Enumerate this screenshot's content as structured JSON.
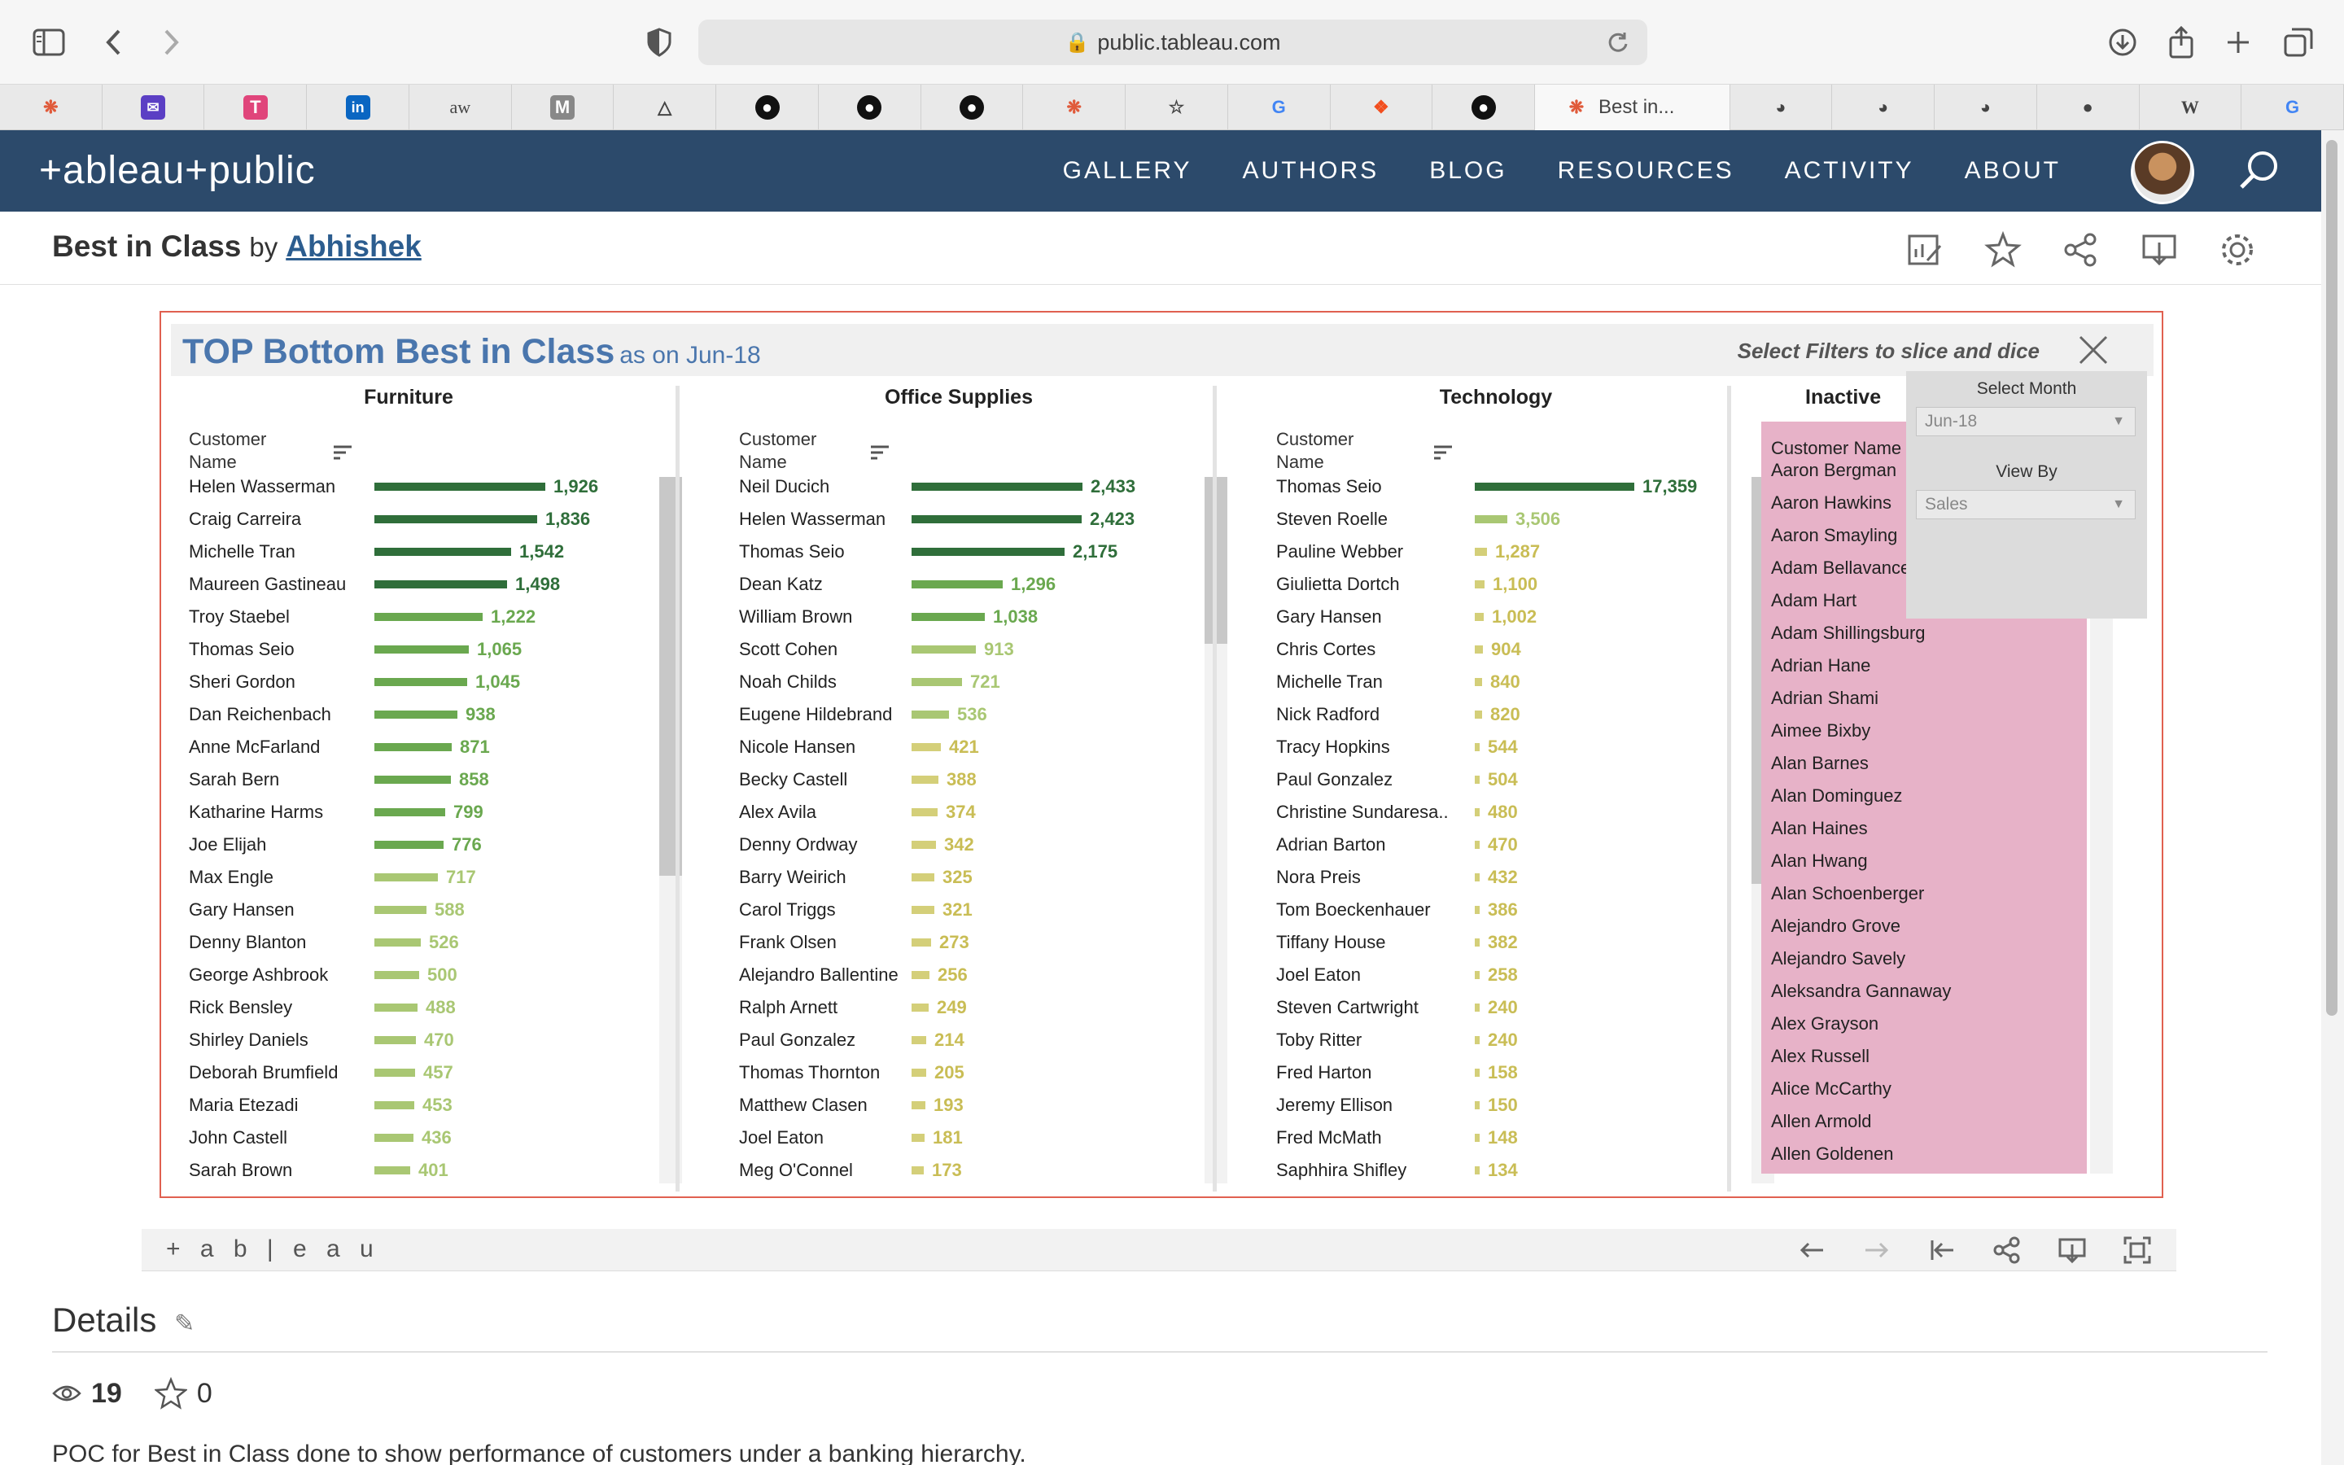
{
  "browser": {
    "url": "public.tableau.com",
    "active_tab_title": "Best in..."
  },
  "tabs": [
    {
      "icon": "tableau-icon",
      "label": ""
    },
    {
      "icon": "mail-icon",
      "label": ""
    },
    {
      "icon": "text-icon",
      "label": ""
    },
    {
      "icon": "linkedin-icon",
      "label": ""
    },
    {
      "icon": "aw-icon",
      "label": "aw"
    },
    {
      "icon": "medium-icon",
      "label": ""
    },
    {
      "icon": "compass-icon",
      "label": ""
    },
    {
      "icon": "github-icon",
      "label": ""
    },
    {
      "icon": "github-icon",
      "label": ""
    },
    {
      "icon": "github-icon",
      "label": ""
    },
    {
      "icon": "tableau-icon",
      "label": ""
    },
    {
      "icon": "star-icon",
      "label": ""
    },
    {
      "icon": "google-icon",
      "label": ""
    },
    {
      "icon": "figma-icon",
      "label": ""
    },
    {
      "icon": "github-icon",
      "label": ""
    }
  ],
  "tabs_right": [
    {
      "icon": "safari-icon"
    },
    {
      "icon": "safari-icon"
    },
    {
      "icon": "safari-icon"
    },
    {
      "icon": "apple-icon"
    },
    {
      "icon": "wikipedia-icon",
      "label": "W"
    },
    {
      "icon": "google-icon"
    }
  ],
  "header": {
    "logo": "+ableau+public",
    "nav": [
      "GALLERY",
      "AUTHORS",
      "BLOG",
      "RESOURCES",
      "ACTIVITY",
      "ABOUT"
    ]
  },
  "viz": {
    "title": "Best in Class",
    "by": "by",
    "author": "Abhishek"
  },
  "dashboard": {
    "title": "TOP Bottom Best in Class",
    "subtitle": "as on Jun-18",
    "filter_hint": "Select Filters to slice and dice",
    "column_header": "Customer Name",
    "filter_panel": {
      "month_label": "Select Month",
      "month_value": "Jun-18",
      "viewby_label": "View By",
      "viewby_value": "Sales"
    },
    "colors": {
      "dark_green": "#2f6e3a",
      "mid_green": "#6aa84f",
      "light_green": "#a9c773",
      "khaki": "#d4cf79",
      "pink": "#e7b2c8",
      "title_blue": "#4a76ad"
    },
    "panes": [
      {
        "title": "Furniture",
        "rows": [
          {
            "name": "Helen Wasserman",
            "value": "1,926"
          },
          {
            "name": "Craig Carreira",
            "value": "1,836"
          },
          {
            "name": "Michelle Tran",
            "value": "1,542"
          },
          {
            "name": "Maureen Gastineau",
            "value": "1,498"
          },
          {
            "name": "Troy Staebel",
            "value": "1,222"
          },
          {
            "name": "Thomas Seio",
            "value": "1,065"
          },
          {
            "name": "Sheri Gordon",
            "value": "1,045"
          },
          {
            "name": "Dan Reichenbach",
            "value": "938"
          },
          {
            "name": "Anne McFarland",
            "value": "871"
          },
          {
            "name": "Sarah Bern",
            "value": "858"
          },
          {
            "name": "Katharine Harms",
            "value": "799"
          },
          {
            "name": "Joe Elijah",
            "value": "776"
          },
          {
            "name": "Max Engle",
            "value": "717"
          },
          {
            "name": "Gary Hansen",
            "value": "588"
          },
          {
            "name": "Denny Blanton",
            "value": "526"
          },
          {
            "name": "George Ashbrook",
            "value": "500"
          },
          {
            "name": "Rick Bensley",
            "value": "488"
          },
          {
            "name": "Shirley Daniels",
            "value": "470"
          },
          {
            "name": "Deborah Brumfield",
            "value": "457"
          },
          {
            "name": "Maria Etezadi",
            "value": "453"
          },
          {
            "name": "John Castell",
            "value": "436"
          },
          {
            "name": "Sarah Brown",
            "value": "401"
          }
        ]
      },
      {
        "title": "Office Supplies",
        "rows": [
          {
            "name": "Neil Ducich",
            "value": "2,433"
          },
          {
            "name": "Helen Wasserman",
            "value": "2,423"
          },
          {
            "name": "Thomas Seio",
            "value": "2,175"
          },
          {
            "name": "Dean Katz",
            "value": "1,296"
          },
          {
            "name": "William Brown",
            "value": "1,038"
          },
          {
            "name": "Scott Cohen",
            "value": "913"
          },
          {
            "name": "Noah Childs",
            "value": "721"
          },
          {
            "name": "Eugene Hildebrand",
            "value": "536"
          },
          {
            "name": "Nicole Hansen",
            "value": "421"
          },
          {
            "name": "Becky Castell",
            "value": "388"
          },
          {
            "name": "Alex Avila",
            "value": "374"
          },
          {
            "name": "Denny Ordway",
            "value": "342"
          },
          {
            "name": "Barry Weirich",
            "value": "325"
          },
          {
            "name": "Carol Triggs",
            "value": "321"
          },
          {
            "name": "Frank Olsen",
            "value": "273"
          },
          {
            "name": "Alejandro Ballentine",
            "value": "256"
          },
          {
            "name": "Ralph Arnett",
            "value": "249"
          },
          {
            "name": "Paul Gonzalez",
            "value": "214"
          },
          {
            "name": "Thomas Thornton",
            "value": "205"
          },
          {
            "name": "Matthew Clasen",
            "value": "193"
          },
          {
            "name": "Joel Eaton",
            "value": "181"
          },
          {
            "name": "Meg O'Connel",
            "value": "173"
          }
        ]
      },
      {
        "title": "Technology",
        "rows": [
          {
            "name": "Thomas Seio",
            "value": "17,359"
          },
          {
            "name": "Steven Roelle",
            "value": "3,506"
          },
          {
            "name": "Pauline Webber",
            "value": "1,287"
          },
          {
            "name": "Giulietta Dortch",
            "value": "1,100"
          },
          {
            "name": "Gary Hansen",
            "value": "1,002"
          },
          {
            "name": "Chris Cortes",
            "value": "904"
          },
          {
            "name": "Michelle Tran",
            "value": "840"
          },
          {
            "name": "Nick Radford",
            "value": "820"
          },
          {
            "name": "Tracy Hopkins",
            "value": "544"
          },
          {
            "name": "Paul Gonzalez",
            "value": "504"
          },
          {
            "name": "Christine Sundaresa..",
            "value": "480"
          },
          {
            "name": "Adrian Barton",
            "value": "470"
          },
          {
            "name": "Nora Preis",
            "value": "432"
          },
          {
            "name": "Tom Boeckenhauer",
            "value": "386"
          },
          {
            "name": "Tiffany House",
            "value": "382"
          },
          {
            "name": "Joel Eaton",
            "value": "258"
          },
          {
            "name": "Steven Cartwright",
            "value": "240"
          },
          {
            "name": "Toby Ritter",
            "value": "240"
          },
          {
            "name": "Fred Harton",
            "value": "158"
          },
          {
            "name": "Jeremy Ellison",
            "value": "150"
          },
          {
            "name": "Fred McMath",
            "value": "148"
          },
          {
            "name": "Saphhira Shifley",
            "value": "134"
          }
        ]
      }
    ],
    "inactive": {
      "title": "Inactive",
      "names": [
        "Aaron Bergman",
        "Aaron Hawkins",
        "Aaron Smayling",
        "Adam Bellavance",
        "Adam Hart",
        "Adam Shillingsburg",
        "Adrian Hane",
        "Adrian Shami",
        "Aimee Bixby",
        "Alan Barnes",
        "Alan Dominguez",
        "Alan Haines",
        "Alan Hwang",
        "Alan Schoenberger",
        "Alejandro Grove",
        "Alejandro Savely",
        "Aleksandra Gannaway",
        "Alex Grayson",
        "Alex Russell",
        "Alice McCarthy",
        "Allen Armold",
        "Allen Goldenen"
      ]
    }
  },
  "footer": {
    "logo": "+ a b | e a u",
    "details_label": "Details",
    "views": "19",
    "favorites": "0",
    "description": "POC for Best in Class done to show performance of customers under a banking hierarchy."
  }
}
